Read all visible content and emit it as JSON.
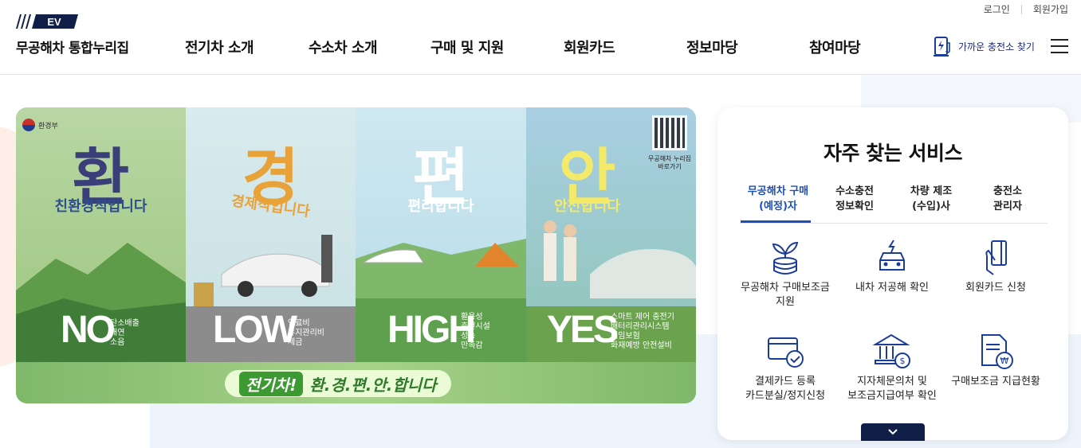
{
  "header": {
    "util_links": [
      "로그인",
      "회원가입"
    ],
    "logo_badge": "EV",
    "logo_text": "무공해차 통합누리집",
    "nav": [
      "전기차 소개",
      "수소차 소개",
      "구매 및 지원",
      "회원카드",
      "정보마당",
      "참여마당"
    ],
    "charger_link": "가까운 충전소 찾기",
    "menu_icon": "hamburger-icon"
  },
  "banner": {
    "ministry": "환경부",
    "panels": [
      {
        "big": "환",
        "sub": "친환경적입니다",
        "word": "NO",
        "desc": [
          "탄소배출",
          "매연",
          "소음"
        ]
      },
      {
        "big": "경",
        "sub": "경제적입니다",
        "word": "LOW",
        "desc": [
          "연료비",
          "유지관리비",
          "세금"
        ]
      },
      {
        "big": "편",
        "sub": "편리합니다",
        "word": "HIGH",
        "desc": [
          "활용성",
          "충전시설",
          "성능",
          "만족감"
        ]
      },
      {
        "big": "안",
        "sub": "안전합니다",
        "word": "YES",
        "desc": [
          "스마트 제어 충전기",
          "배터리관리시스템",
          "책임보험",
          "화재예방 안전설비"
        ]
      }
    ],
    "qr_caption": [
      "무공해차 누리집",
      "바로가기"
    ],
    "slogan_tag": "전기차!",
    "slogan_text": "환.경.편.안.합니다"
  },
  "services": {
    "title": "자주 찾는 서비스",
    "tabs": [
      {
        "line1": "무공해차 구매",
        "line2": "(예정)자"
      },
      {
        "line1": "수소충전",
        "line2": "정보확인"
      },
      {
        "line1": "차량 제조",
        "line2": "(수입)사"
      },
      {
        "line1": "충전소",
        "line2": "관리자"
      }
    ],
    "items": [
      {
        "line1": "무공해차 구매보조금",
        "line2": "지원",
        "icon": "coins-plant-icon"
      },
      {
        "line1": "내차 저공해 확인",
        "line2": "",
        "icon": "car-eco-icon"
      },
      {
        "line1": "회원카드 신청",
        "line2": "",
        "icon": "card-hand-icon"
      },
      {
        "line1": "결제카드 등록",
        "line2": "카드분실/정지신청",
        "icon": "card-check-icon"
      },
      {
        "line1": "지자체문의처 및",
        "line2": "보조금지급여부 확인",
        "icon": "government-building-icon"
      },
      {
        "line1": "구매보조금 지급현황",
        "line2": "",
        "icon": "document-won-icon"
      }
    ]
  },
  "colors": {
    "accent": "#1b4fbb",
    "navy": "#0f1f48"
  }
}
